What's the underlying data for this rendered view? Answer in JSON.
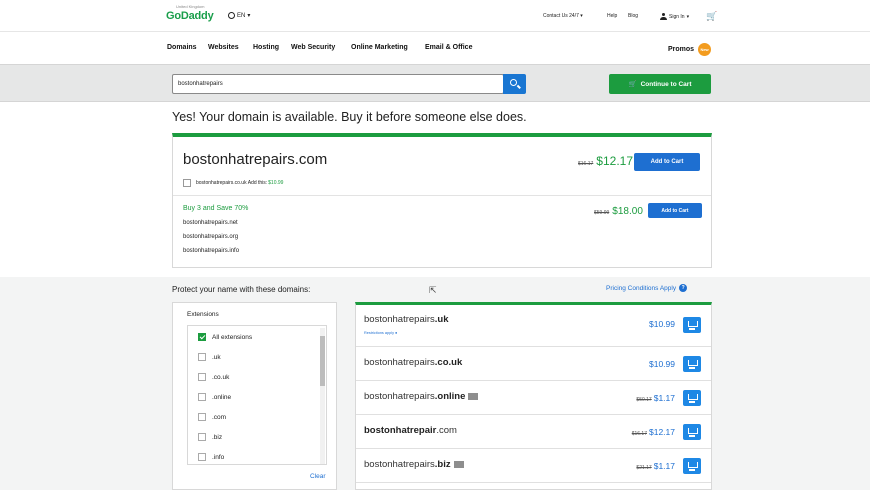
{
  "brand": {
    "logo": "GoDaddy",
    "sub": "United Kingdom",
    "lang": "EN"
  },
  "topnav": {
    "contact": "Contact Us 24/7",
    "help": "Help",
    "blog": "Blog",
    "signin": "Sign In"
  },
  "mainnav": [
    "Domains",
    "Websites",
    "Hosting",
    "Web Security",
    "Online Marketing",
    "Email & Office"
  ],
  "promos": {
    "label": "Promos",
    "badge": "New"
  },
  "search": {
    "value": "bostonhatrepairs"
  },
  "continue_label": "Continue to Cart",
  "availability": "Yes! Your domain is available. Buy it before someone else does.",
  "primary": {
    "domain": "bostonhatrepairs.com",
    "old_price": "$16.17",
    "price": "$12.17",
    "add_label": "Add to Cart",
    "addon_text": "bostonhatrepairs.co.uk Add this:",
    "addon_price": "$10.99"
  },
  "bundle": {
    "title": "Buy 3 and Save 70%",
    "items": [
      "bostonhatrepairs.net",
      "bostonhatrepairs.org",
      "bostonhatrepairs.info"
    ],
    "old_price": "$59.99",
    "price": "$18.00",
    "add_label": "Add to Cart"
  },
  "protect_title": "Protect your name with these domains:",
  "pricing_link": "Pricing Conditions Apply",
  "filters": {
    "title": "Extensions",
    "items": [
      {
        "label": "All extensions"
      },
      {
        "label": ".uk"
      },
      {
        "label": ".co.uk"
      },
      {
        "label": ".online"
      },
      {
        "label": ".com"
      },
      {
        "label": ".biz"
      },
      {
        "label": ".info"
      }
    ],
    "clear": "Clear"
  },
  "results": [
    {
      "base": "bostonhatrepairs",
      "tld": ".uk",
      "price": "$10.99",
      "old": "",
      "restrictions": "Restrictions apply"
    },
    {
      "base": "bostonhatrepairs",
      "tld": ".co.uk",
      "price": "$10.99",
      "old": "",
      "restrictions": ""
    },
    {
      "base": "bostonhatrepairs",
      "tld": ".online",
      "price": "$1.17",
      "old": "$50.17",
      "restrictions": ""
    },
    {
      "base": "bostonhatrepair",
      "tld": ".com",
      "price": "$12.17",
      "old": "$16.17",
      "restrictions": ""
    },
    {
      "base": "bostonhatrepairs",
      "tld": ".biz",
      "price": "$1.17",
      "old": "$21.17",
      "restrictions": ""
    }
  ]
}
